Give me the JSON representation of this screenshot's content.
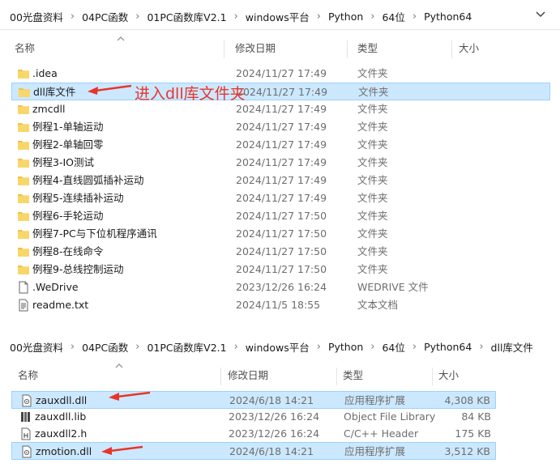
{
  "top": {
    "breadcrumb": [
      "00光盘资料",
      "04PC函数",
      "01PC函数库V2.1",
      "windows平台",
      "Python",
      "64位",
      "Python64"
    ],
    "headers": {
      "name": "名称",
      "date": "修改日期",
      "type": "类型",
      "size": "大小"
    },
    "rows": [
      {
        "icon": "folder-icon",
        "name": ".idea",
        "date": "2024/11/27 17:49",
        "type": "文件夹"
      },
      {
        "icon": "folder-icon",
        "name": "dll库文件",
        "date": "2024/11/27 17:49",
        "type": "文件夹",
        "selected": true
      },
      {
        "icon": "folder-icon",
        "name": "zmcdll",
        "date": "2024/11/27 17:49",
        "type": "文件夹"
      },
      {
        "icon": "folder-icon",
        "name": "例程1-单轴运动",
        "date": "2024/11/27 17:49",
        "type": "文件夹"
      },
      {
        "icon": "folder-icon",
        "name": "例程2-单轴回零",
        "date": "2024/11/27 17:49",
        "type": "文件夹"
      },
      {
        "icon": "folder-icon",
        "name": "例程3-IO测试",
        "date": "2024/11/27 17:49",
        "type": "文件夹"
      },
      {
        "icon": "folder-icon",
        "name": "例程4-直线圆弧插补运动",
        "date": "2024/11/27 17:49",
        "type": "文件夹"
      },
      {
        "icon": "folder-icon",
        "name": "例程5-连续插补运动",
        "date": "2024/11/27 17:49",
        "type": "文件夹"
      },
      {
        "icon": "folder-icon",
        "name": "例程6-手轮运动",
        "date": "2024/11/27 17:50",
        "type": "文件夹"
      },
      {
        "icon": "folder-icon",
        "name": "例程7-PC与下位机程序通讯",
        "date": "2024/11/27 17:50",
        "type": "文件夹"
      },
      {
        "icon": "folder-icon",
        "name": "例程8-在线命令",
        "date": "2024/11/27 17:50",
        "type": "文件夹"
      },
      {
        "icon": "folder-icon",
        "name": "例程9-总线控制运动",
        "date": "2024/11/27 17:50",
        "type": "文件夹"
      },
      {
        "icon": "file-icon",
        "name": ".WeDrive",
        "date": "2023/12/26 16:24",
        "type": "WEDRIVE 文件"
      },
      {
        "icon": "text-file-icon",
        "name": "readme.txt",
        "date": "2024/11/5 18:55",
        "type": "文本文档"
      }
    ],
    "annotation": "进入dll库文件夹"
  },
  "bottom": {
    "breadcrumb": [
      "00光盘资料",
      "04PC函数",
      "01PC函数库V2.1",
      "windows平台",
      "Python",
      "64位",
      "Python64",
      "dll库文件"
    ],
    "headers": {
      "name": "名称",
      "date": "修改日期",
      "type": "类型",
      "size": "大小"
    },
    "rows": [
      {
        "icon": "dll-icon",
        "name": "zauxdll.dll",
        "date": "2024/6/18 14:21",
        "type": "应用程序扩展",
        "size": "4,308 KB",
        "selected": true
      },
      {
        "icon": "lib-icon",
        "name": "zauxdll.lib",
        "date": "2023/12/26 16:24",
        "type": "Object File Library",
        "size": "84 KB"
      },
      {
        "icon": "h-file-icon",
        "name": "zauxdll2.h",
        "date": "2023/12/26 16:24",
        "type": "C/C++ Header",
        "size": "175 KB"
      },
      {
        "icon": "dll-icon",
        "name": "zmotion.dll",
        "date": "2024/6/18 14:21",
        "type": "应用程序扩展",
        "size": "3,512 KB",
        "selected": true
      }
    ]
  },
  "colors": {
    "accent": "#e8352b",
    "selection": "#cce8ff",
    "folder": "#f3c243"
  }
}
